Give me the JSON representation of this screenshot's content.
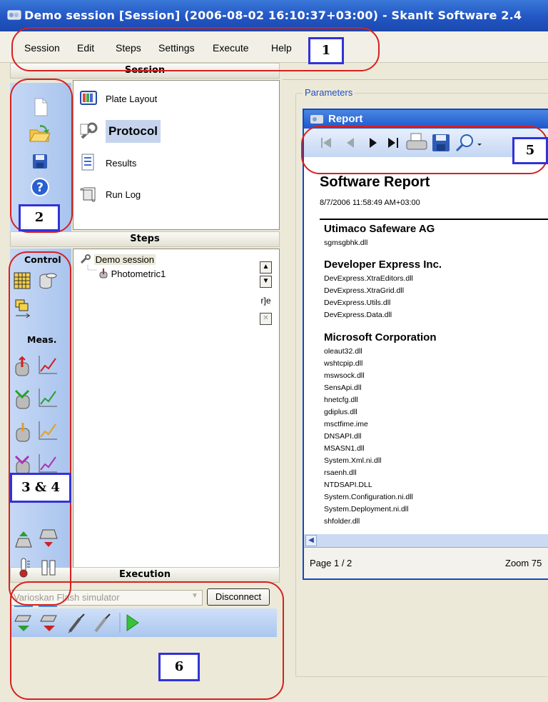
{
  "window": {
    "title": "Demo session [Session] (2006-08-02 16:10:37+03:00) - SkanIt Software 2.4"
  },
  "menu": [
    "Session",
    "Edit",
    "Steps",
    "Settings",
    "Execute",
    "Help"
  ],
  "callouts": {
    "c1": "1",
    "c2": "2",
    "c34": "3 & 4",
    "c5": "5",
    "c6": "6"
  },
  "session": {
    "header": "Session",
    "items": [
      {
        "label": "Plate Layout",
        "icon": "plate-layout-icon"
      },
      {
        "label": "Protocol",
        "icon": "protocol-icon",
        "selected": true
      },
      {
        "label": "Results",
        "icon": "results-icon"
      },
      {
        "label": "Run Log",
        "icon": "run-log-icon"
      }
    ],
    "toolbar_icons": [
      "new-document-icon",
      "open-folder-icon",
      "save-icon",
      "help-icon"
    ]
  },
  "steps": {
    "header": "Steps",
    "control_label": "Control",
    "meas_label": "Meas.",
    "tree": [
      {
        "label": "Demo session",
        "icon": "wrench-icon"
      },
      {
        "label": "Photometric1",
        "icon": "photometric-icon"
      }
    ]
  },
  "execution": {
    "header": "Execution",
    "instrument": "Varioskan Flash simulator",
    "disconnect_label": "Disconnect"
  },
  "parameters": {
    "label": "Parameters"
  },
  "report": {
    "title": "Report",
    "doc_title": "Software Report",
    "timestamp": "8/7/2006 11:58:49 AM+03:00",
    "sections": [
      {
        "company": "Utimaco Safeware AG",
        "files": [
          "sgmsgbhk.dll"
        ]
      },
      {
        "company": "Developer Express Inc.",
        "files": [
          "DevExpress.XtraEditors.dll",
          "DevExpress.XtraGrid.dll",
          "DevExpress.Utils.dll",
          "DevExpress.Data.dll"
        ]
      },
      {
        "company": "Microsoft Corporation",
        "files": [
          "oleaut32.dll",
          "wshtcpip.dll",
          "mswsock.dll",
          "SensApi.dll",
          "hnetcfg.dll",
          "gdiplus.dll",
          "msctfime.ime",
          "DNSAPI.dll",
          "MSASN1.dll",
          "System.Xml.ni.dll",
          "rsaenh.dll",
          "NTDSAPI.DLL",
          "System.Configuration.ni.dll",
          "System.Deployment.ni.dll",
          "shfolder.dll"
        ]
      }
    ],
    "page": "Page 1 / 2",
    "zoom": "Zoom 75"
  },
  "colors": {
    "callout_red": "#d72020",
    "callout_blue": "#3232d8",
    "title_blue": "#2256c4"
  }
}
